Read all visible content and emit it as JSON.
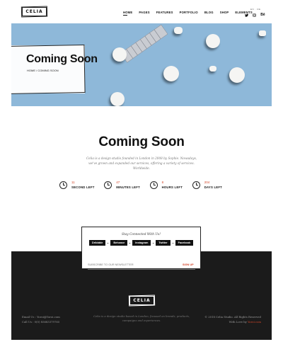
{
  "header": {
    "logo": "CELIA",
    "nav": [
      "HOME",
      "PAGES",
      "FEATURES",
      "PORTFOLIO",
      "BLOG",
      "SHOP",
      "ELEMENTS"
    ],
    "lang": "EN · DE",
    "social_icons": [
      "twitter-icon",
      "instagram-icon",
      "behance-icon"
    ]
  },
  "hero": {
    "title": "Coming Soon",
    "breadcrumb": "HOME / COMING SOON"
  },
  "main": {
    "title": "Coming Soon",
    "description": "Celia is a design studio founded in London in 2008 by Sophie. Nowadays, we've grown and expanded our services, offering a variety of services. Worldwide."
  },
  "countdown": [
    {
      "value": "11",
      "label": "SECOND LEFT"
    },
    {
      "value": "47",
      "label": "MINUTES LEFT"
    },
    {
      "value": "8",
      "label": "HOURS LEFT"
    },
    {
      "value": "204",
      "label": "DAYS LEFT"
    }
  ],
  "connect": {
    "title": "Stay Connected With Us!",
    "links": [
      "Dribbble",
      "Behance",
      "Instagram",
      "Twitter",
      "Facebook"
    ]
  },
  "subscribe": {
    "placeholder": "SUBSCRIBE TO OUR NEWSLETTER",
    "button": "SIGN UP"
  },
  "footer": {
    "logo": "CELIA",
    "description": "Celia is a design studio based in London, focused on brands, products, campaigns and experiences.",
    "email": "Email Us : Yoroi@Yoroi.com",
    "phone": "Call Us : 0(0) 85683379765",
    "copyright": "© 2018 Celia Studio. All Rights Reserved",
    "love_prefix": "With Love by ",
    "love_link": "Yoroi.com"
  },
  "colors": {
    "accent": "#d4462a",
    "hero_bg": "#8eb8d9",
    "footer_bg": "#1b1b1b"
  }
}
